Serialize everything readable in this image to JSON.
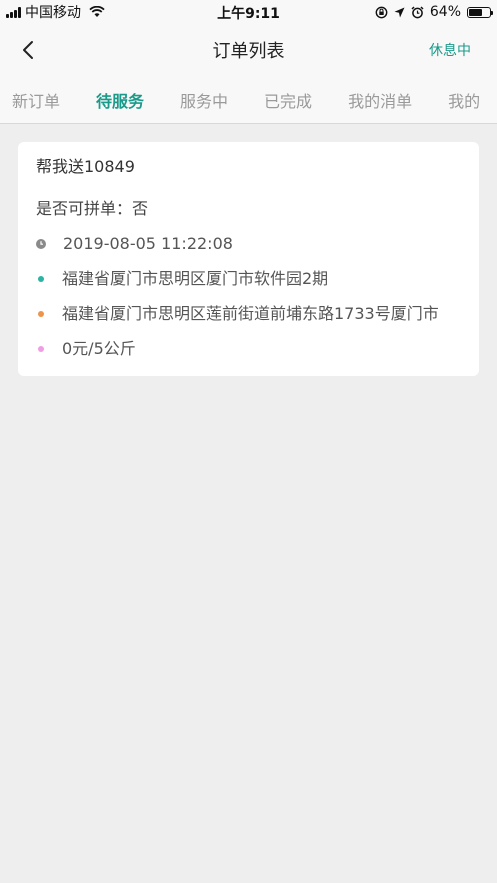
{
  "status_bar": {
    "carrier": "中国移动",
    "time": "上午9:11",
    "battery_percent": "64%",
    "battery_level": 0.64
  },
  "nav": {
    "title": "订单列表",
    "right_label": "休息中"
  },
  "tabs": [
    {
      "label": "新订单"
    },
    {
      "label": "待服务"
    },
    {
      "label": "服务中"
    },
    {
      "label": "已完成"
    },
    {
      "label": "我的消单"
    },
    {
      "label": "我的"
    }
  ],
  "order": {
    "title": "帮我送10849",
    "combinable": "是否可拼单：否",
    "time": "2019-08-05 11:22:08",
    "pickup": "福建省厦门市思明区厦门市软件园2期",
    "dropoff": "福建省厦门市思明区莲前街道前埔东路1733号厦门市",
    "price": "0元/5公斤"
  },
  "colors": {
    "accent": "#1a9a8a",
    "pickup_dot": "#2bb3a3",
    "dropoff_dot": "#f0934a",
    "price_dot": "#f19de3"
  }
}
